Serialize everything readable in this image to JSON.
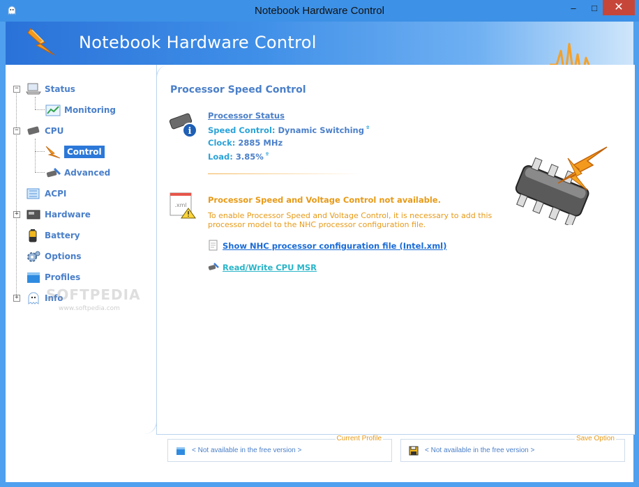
{
  "window": {
    "title": "Notebook Hardware Control",
    "minimize": "–",
    "maximize": "□",
    "close": "✕"
  },
  "header": {
    "app_title": "Notebook Hardware Control"
  },
  "sidebar": {
    "items": [
      {
        "label": "Status",
        "icon": "laptop-icon"
      },
      {
        "label": "Monitoring",
        "icon": "chart-icon"
      },
      {
        "label": "CPU",
        "icon": "chip-icon"
      },
      {
        "label": "Control",
        "icon": "lightning-icon"
      },
      {
        "label": "Advanced",
        "icon": "wrench-icon"
      },
      {
        "label": "ACPI",
        "icon": "acpi-icon"
      },
      {
        "label": "Hardware",
        "icon": "hardware-icon"
      },
      {
        "label": "Battery",
        "icon": "battery-icon"
      },
      {
        "label": "Options",
        "icon": "gear-icon"
      },
      {
        "label": "Profiles",
        "icon": "profiles-icon"
      },
      {
        "label": "Info",
        "icon": "info-ghost-icon"
      }
    ],
    "selected": "Control"
  },
  "main": {
    "section_title": "Processor Speed Control",
    "processor_status_link": "Processor Status",
    "speed_control_label": "Speed Control:",
    "speed_control_value": "Dynamic Switching",
    "clock_label": "Clock:",
    "clock_value": "2885 MHz",
    "load_label": "Load:",
    "load_value": "3.85%",
    "info_marker": "º",
    "warning_title": "Processor Speed and Voltage Control not available.",
    "warning_text": "To enable Processor Speed and Voltage Control, it is necessary to add this processor model to the NHC processor configuration file.",
    "xml_icon_label": ".xml",
    "show_config_link": "Show NHC processor configuration file (Intel.xml)",
    "read_write_msr_link": "Read/Write CPU MSR"
  },
  "footer": {
    "current_profile_legend": "Current Profile",
    "current_profile_value": "< Not available in the free version >",
    "save_option_legend": "Save Option",
    "save_option_value": "< Not available in the free version >"
  },
  "watermark": {
    "text": "SOFTPEDIA",
    "url": "www.softpedia.com"
  },
  "colors": {
    "accent": "#4a7fc9",
    "warning": "#e79a17",
    "selection": "#2b78d8",
    "titlebar": "#3d91e6"
  }
}
